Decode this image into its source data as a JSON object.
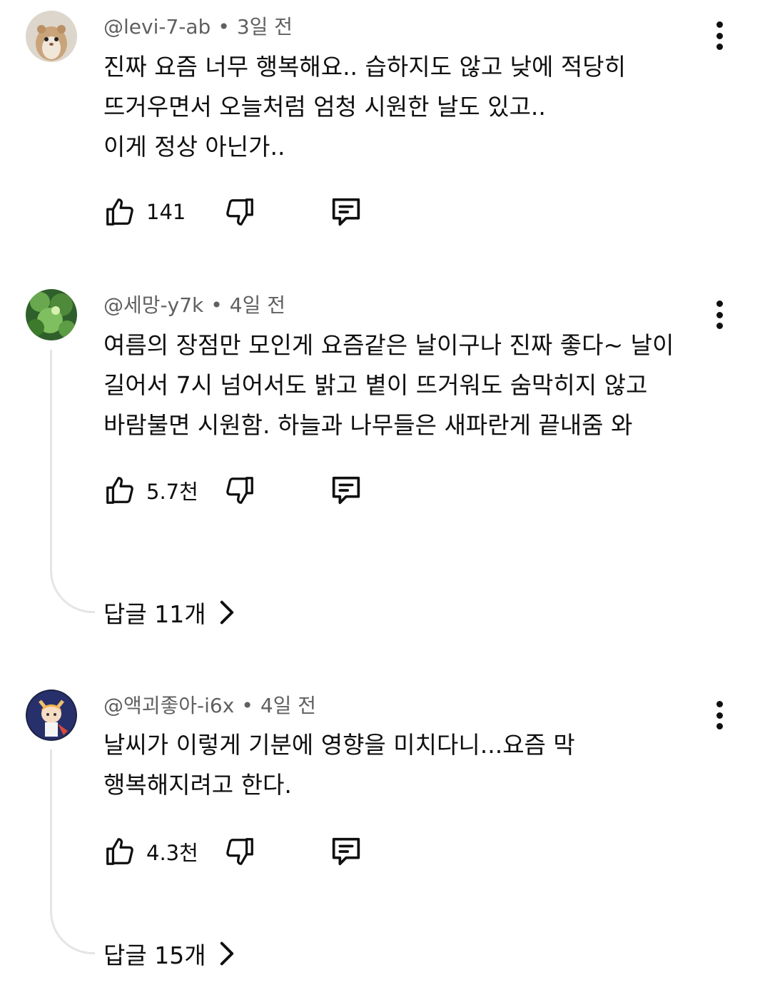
{
  "comments": [
    {
      "author": "@levi-7-ab",
      "time": "3일 전",
      "lines": [
        "진짜 요즘 너무 행복해요.. 습하지도 않고 낮에 적당히",
        "뜨거우면서  오늘처럼 엄청 시원한 날도 있고..",
        "이게 정상 아닌가.."
      ],
      "likes": "141",
      "avatar_icon": "hamster-avatar"
    },
    {
      "author": "@세망-y7k",
      "time": "4일 전",
      "lines": [
        "여름의 장점만 모인게 요즘같은 날이구나  진짜 좋다~ 날이",
        "길어서 7시 넘어서도 밝고 볕이 뜨거워도 숨막히지 않고",
        "바람불면 시원함. 하늘과 나무들은 새파란게 끝내줌 와"
      ],
      "likes": "5.7천",
      "replies": "답글 11개",
      "avatar_icon": "green-leaves-avatar"
    },
    {
      "author": "@액괴좋아-i6x",
      "time": "4일 전",
      "lines": [
        "날씨가 이렇게 기분에 영향을 미치다니...요즘 막",
        "행복해지려고 한다."
      ],
      "likes": "4.3천",
      "replies": "답글 15개",
      "avatar_icon": "anime-girl-avatar"
    }
  ],
  "colors": {
    "meta": "#606060",
    "text": "#0f0f0f",
    "thread": "#e5e5e5"
  },
  "icons": [
    "like-icon",
    "dislike-icon",
    "reply-icon",
    "more-icon",
    "chevron-right-icon"
  ]
}
